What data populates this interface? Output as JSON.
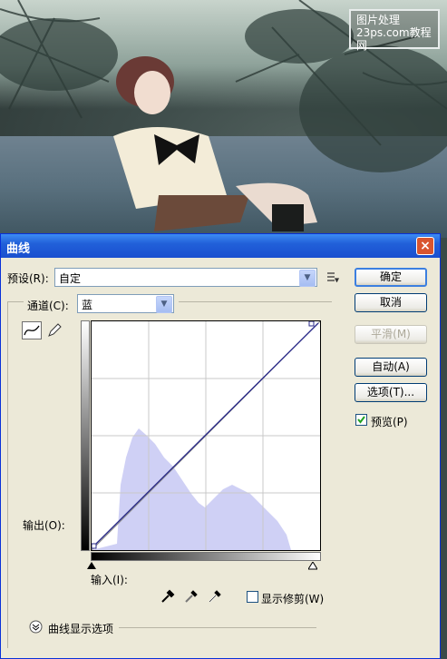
{
  "watermark": {
    "line1": "图片处理",
    "line2": "23ps.com",
    "line3": "教程网"
  },
  "dialog": {
    "title": "曲线",
    "close_icon": "×",
    "preset_label": "预设(R):",
    "preset_value": "自定",
    "channel_label": "通道(C):",
    "channel_value": "蓝",
    "output_label": "输出(O):",
    "input_label": "输入(I):",
    "show_clipping_label": "显示修剪(W)",
    "curve_display_options_label": "曲线显示选项",
    "buttons": {
      "ok": "确定",
      "cancel": "取消",
      "smooth": "平滑(M)",
      "auto": "自动(A)",
      "options": "选项(T)...",
      "preview": "预览(P)"
    },
    "preview_checked": true,
    "show_clipping_checked": false,
    "icons": [
      "curve-tool-icon",
      "pencil-icon",
      "preset-menu-icon",
      "black-eyedropper-icon",
      "gray-eyedropper-icon",
      "white-eyedropper-icon",
      "expand-icon"
    ],
    "histogram_color": "#cfd0f5",
    "accent": "#2160d9"
  }
}
